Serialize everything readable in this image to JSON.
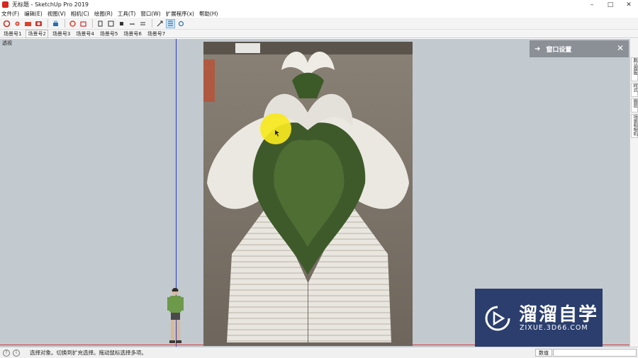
{
  "window": {
    "title": "无标题 - SketchUp Pro 2019",
    "controls": [
      "–",
      "□",
      "✕"
    ]
  },
  "menubar": {
    "items": [
      "文件(F)",
      "编辑(E)",
      "视图(V)",
      "相机(C)",
      "绘图(R)",
      "工具(T)",
      "窗口(W)",
      "扩展程序(x)",
      "帮助(H)"
    ]
  },
  "toolbar": {
    "icons": [
      "getting-started-icon",
      "gear-icon",
      "open-folder-icon",
      "camera-icon",
      "print-icon",
      "settings-icon",
      "box-icon",
      "front-view-icon",
      "top-view-icon",
      "iso-view-icon",
      "back-view-icon",
      "left-view-icon",
      "zoom-extents-icon",
      "section-plane-icon",
      "section-display-icon"
    ]
  },
  "scenes": {
    "tabs": [
      "场景号1",
      "场景号2",
      "场景号3",
      "场景号4",
      "场景号5",
      "场景号6",
      "场景号7"
    ],
    "active_index": 1
  },
  "viewport": {
    "label": "透视"
  },
  "tray": {
    "title": "窗口设置",
    "side_tabs": [
      "默认面板",
      "样式",
      "图层",
      "场景和相机"
    ]
  },
  "watermark": {
    "title": "溜溜自学",
    "url": "ZIXUE.3D66.COM"
  },
  "statusbar": {
    "message": "选择对象。切换到扩充选择。拖动鼠标选择多项。",
    "measurement_label": "数值",
    "measurement_value": ""
  },
  "colors": {
    "viewport_bg": "#c2c9cf",
    "tray_header": "#8b9097",
    "axis_blue": "#2c3cb8",
    "axis_red": "#d34040",
    "cursor_highlight": "#f7e81e",
    "watermark_bg": "#2b3e6d"
  }
}
